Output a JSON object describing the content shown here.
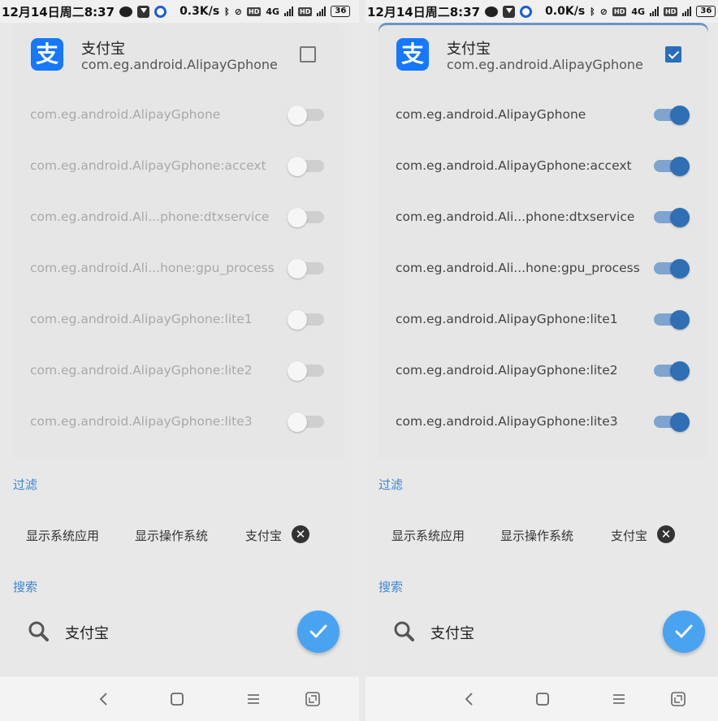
{
  "status_bar": {
    "time": "12月14日周二8:37",
    "net_type": "4G",
    "hd": "HD",
    "battery": "36",
    "left_speed": "0.3K/s",
    "right_speed": "0.0K/s"
  },
  "app": {
    "name": "支付宝",
    "package": "com.eg.android.AlipayGphone",
    "icon_glyph": "支",
    "icon_color": "#1677ff"
  },
  "processes": [
    "com.eg.android.AlipayGphone",
    "com.eg.android.AlipayGphone:accext",
    "com.eg.android.Ali...phone:dtxservice",
    "com.eg.android.Ali...hone:gpu_process",
    "com.eg.android.AlipayGphone:lite1",
    "com.eg.android.AlipayGphone:lite2",
    "com.eg.android.AlipayGphone:lite3"
  ],
  "panels": [
    {
      "id": "left",
      "app_checked": false,
      "toggles_on": false
    },
    {
      "id": "right",
      "app_checked": true,
      "toggles_on": true
    }
  ],
  "filter": {
    "title": "过滤",
    "chips": [
      "显示系统应用",
      "显示操作系统",
      "支付宝"
    ],
    "clear_glyph": "✕"
  },
  "search": {
    "title": "搜索",
    "value": "支付宝"
  },
  "colors": {
    "accent": "#3e86d6",
    "toggle_on": "#2f6fb3",
    "fab": "#4aa3f0"
  },
  "icons": {
    "search": "search-icon",
    "confirm": "check-icon",
    "nav": [
      "back-icon",
      "home-icon",
      "menu-icon",
      "screenshot-icon"
    ]
  }
}
